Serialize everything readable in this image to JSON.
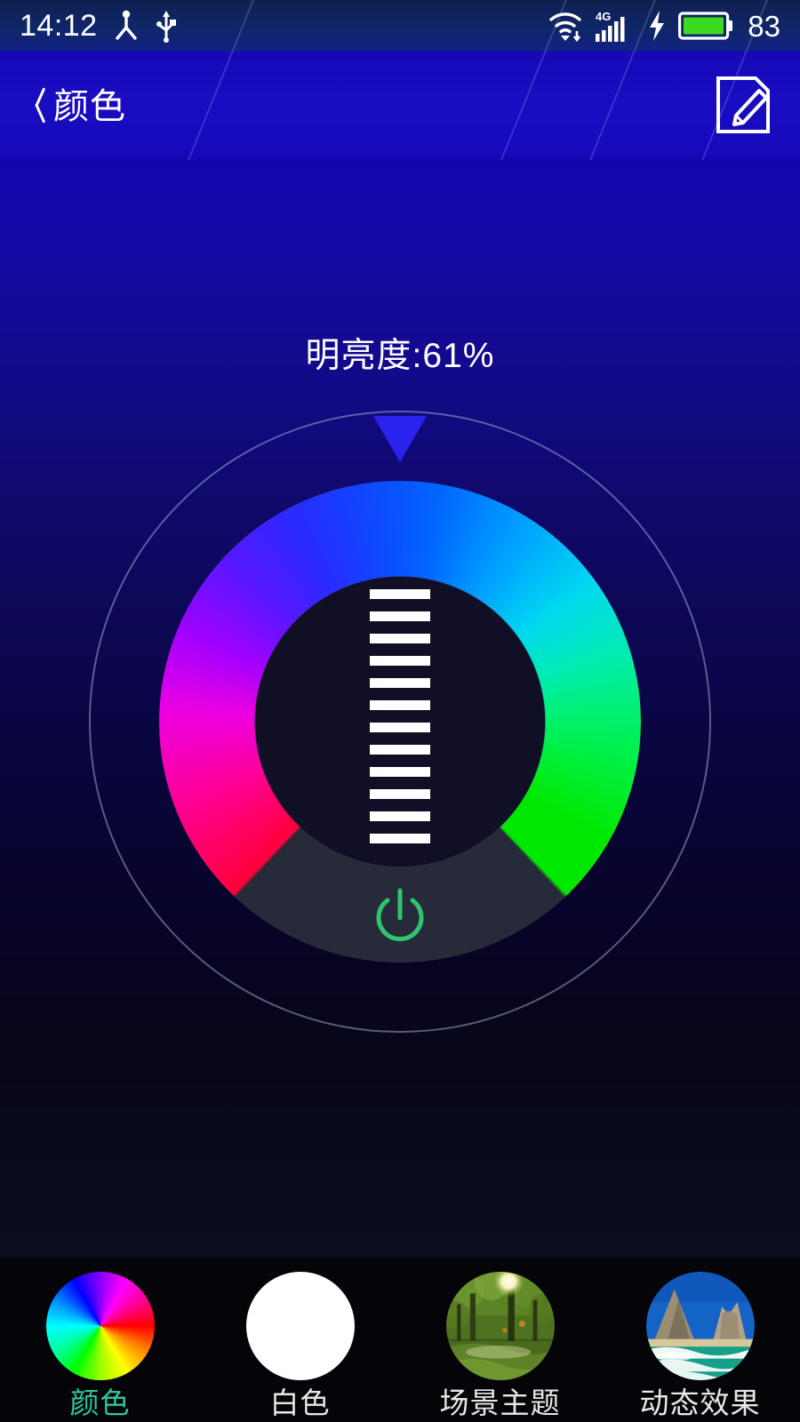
{
  "statusbar": {
    "time": "14:12",
    "battery_percent": "83",
    "icons": [
      "person-share-icon",
      "usb-icon",
      "wifi-icon",
      "signal-4g-icon",
      "charging-bolt-icon",
      "battery-icon"
    ],
    "network_label": "4G",
    "battery_fill_color": "#3ddb1f"
  },
  "header": {
    "title": "颜色",
    "back_icon": "chevron-left-icon",
    "edit_icon": "pencil-edit-icon",
    "background_color": "#1a0cc2"
  },
  "main": {
    "brightness_label": "明亮度:61%",
    "brightness_value": 61,
    "pointer_color": "#2a22ef",
    "power_icon": "power-icon",
    "power_color": "#2fc46f",
    "brightness_bar_count": 12,
    "ring": {
      "outline_color": "#b0bae0",
      "gap_color": "#272a38",
      "inner_disc_color": "#100f26",
      "gradient_stops": [
        "#ff7a00",
        "#ff0033",
        "#ee00e0",
        "#5a16ff",
        "#0066ff",
        "#00d8f0",
        "#00f070",
        "#00e800"
      ]
    }
  },
  "tabbar": {
    "active_color": "#2fc79a",
    "items": [
      {
        "label": "颜色",
        "icon": "color-wheel-icon",
        "active": true
      },
      {
        "label": "白色",
        "icon": "white-circle-icon",
        "active": false
      },
      {
        "label": "场景主题",
        "icon": "forest-scene-icon",
        "active": false
      },
      {
        "label": "动态效果",
        "icon": "beach-scene-icon",
        "active": false
      }
    ]
  }
}
